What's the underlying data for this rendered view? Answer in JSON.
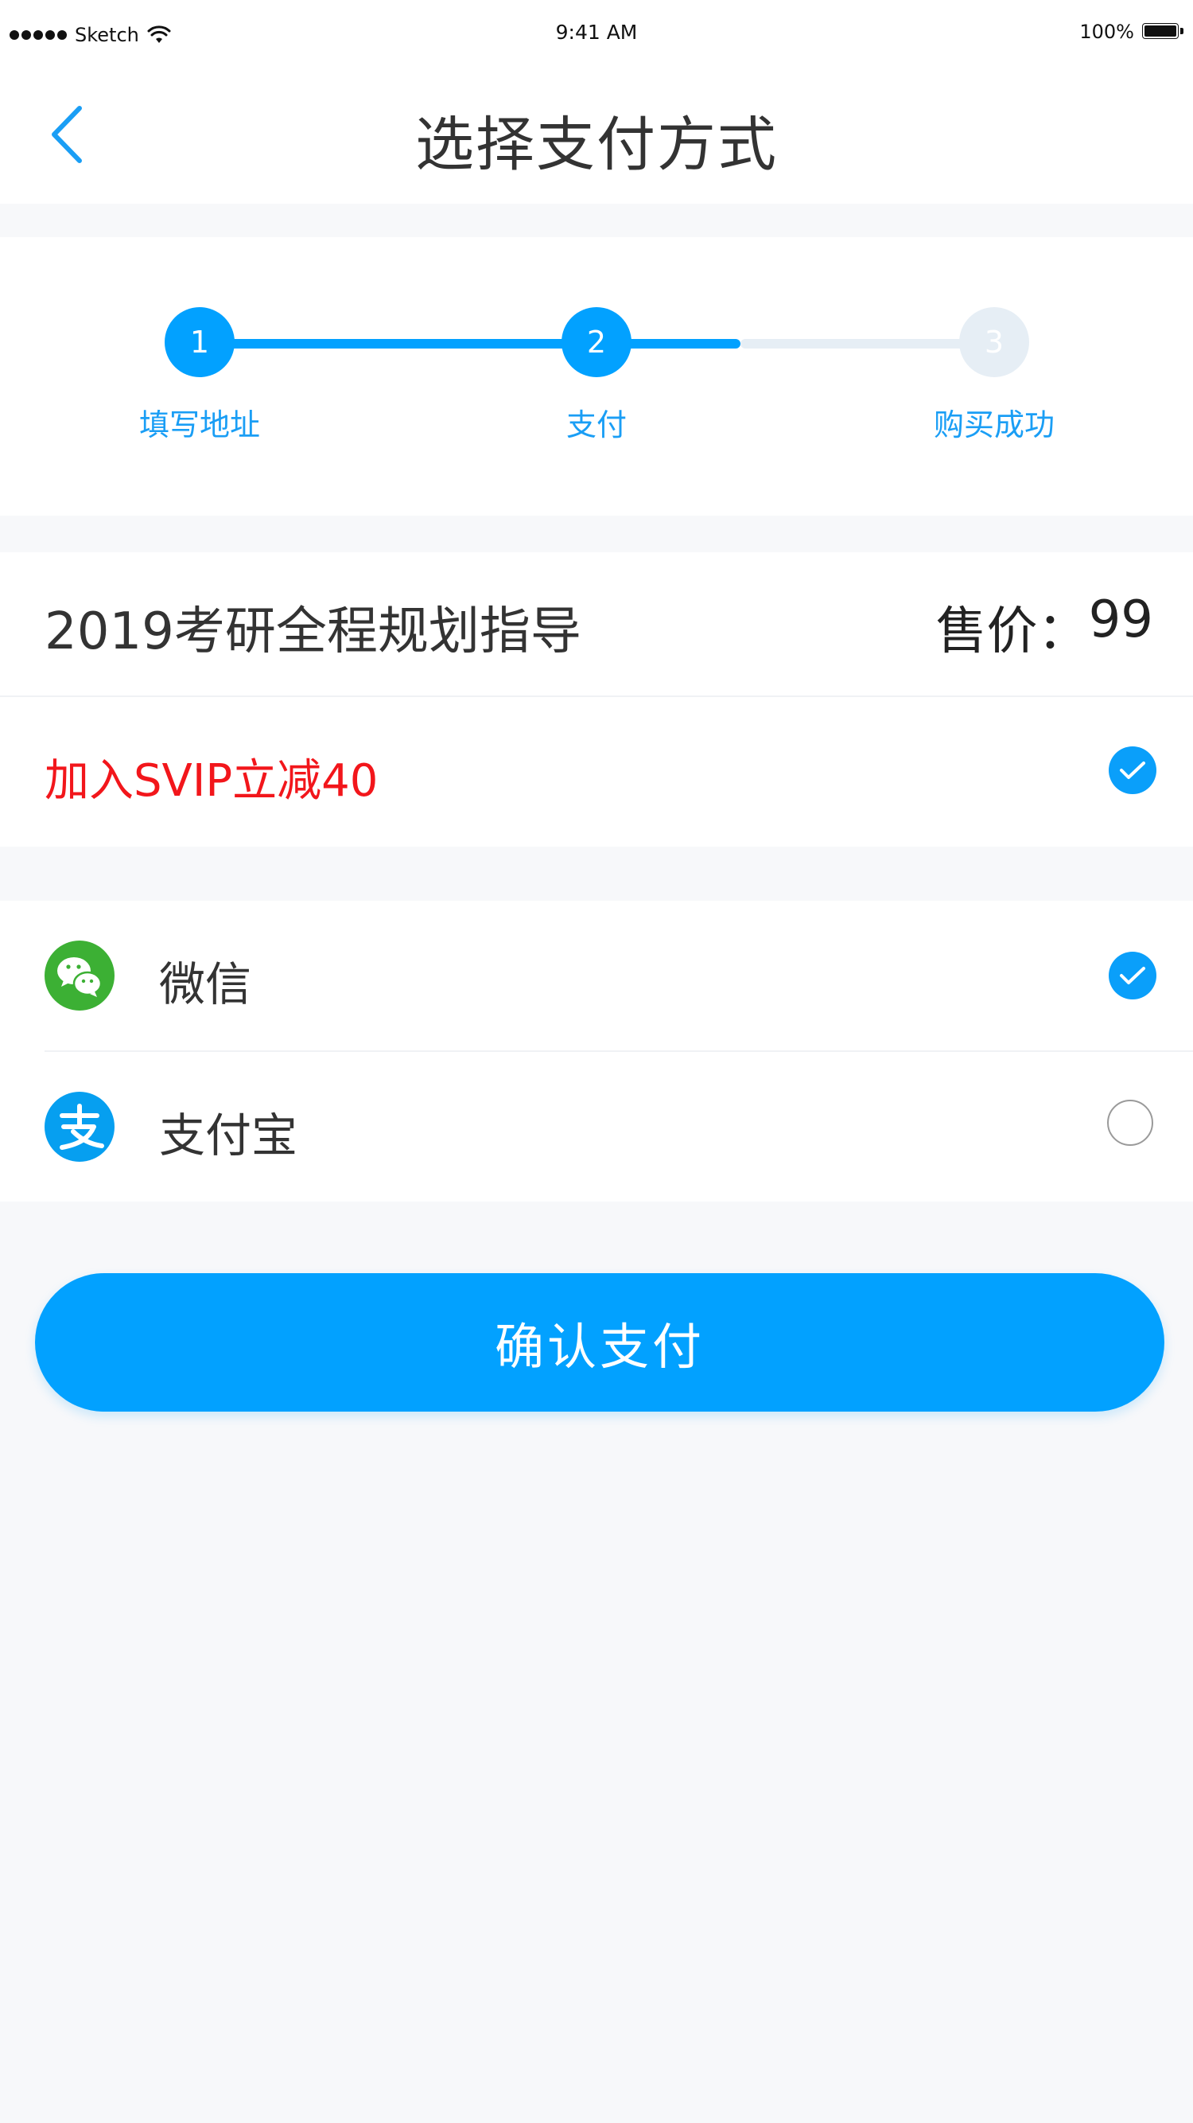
{
  "status_bar": {
    "carrier": "Sketch",
    "time": "9:41 AM",
    "battery": "100%"
  },
  "nav": {
    "title": "选择支付方式",
    "back_icon": "chevron-left-icon"
  },
  "steps": [
    {
      "number": "1",
      "label": "填写地址",
      "state": "done"
    },
    {
      "number": "2",
      "label": "支付",
      "state": "current"
    },
    {
      "number": "3",
      "label": "购买成功",
      "state": "pending"
    }
  ],
  "progress_fraction": 0.68,
  "product": {
    "name": "2019考研全程规划指导",
    "price_label": "售价：",
    "price_value": "99"
  },
  "svip": {
    "label": "加入SVIP立减40",
    "checked": true
  },
  "payment_methods": [
    {
      "name": "微信",
      "icon": "wechat-icon",
      "selected": true
    },
    {
      "name": "支付宝",
      "icon": "alipay-icon",
      "selected": false
    }
  ],
  "confirm_label": "确认支付",
  "colors": {
    "accent": "#02a1ff",
    "discount_text": "#f2161b",
    "wechat_green": "#3cb034",
    "alipay_blue": "#069ff0",
    "background": "#f7f8fa"
  }
}
